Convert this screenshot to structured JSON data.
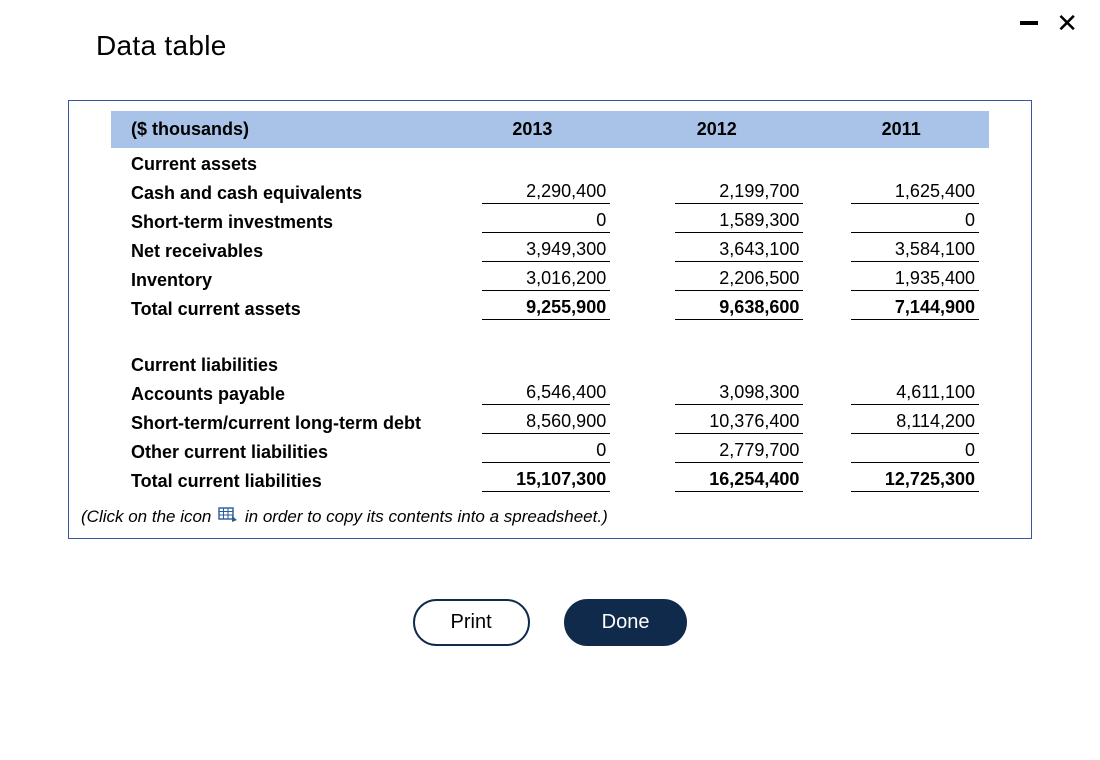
{
  "title": "Data table",
  "columns": {
    "label": "($ thousands)",
    "y1": "2013",
    "y2": "2012",
    "y3": "2011"
  },
  "sections": {
    "assets": {
      "header": "Current assets",
      "rows": [
        {
          "label": "Cash and cash equivalents",
          "v": [
            "2,290,400",
            "2,199,700",
            "1,625,400"
          ]
        },
        {
          "label": "Short-term investments",
          "v": [
            "0",
            "1,589,300",
            "0"
          ]
        },
        {
          "label": "Net receivables",
          "v": [
            "3,949,300",
            "3,643,100",
            "3,584,100"
          ]
        },
        {
          "label": "Inventory",
          "v": [
            "3,016,200",
            "2,206,500",
            "1,935,400"
          ]
        }
      ],
      "total": {
        "label": "Total current assets",
        "v": [
          "9,255,900",
          "9,638,600",
          "7,144,900"
        ]
      }
    },
    "liabilities": {
      "header": "Current liabilities",
      "rows": [
        {
          "label": "Accounts payable",
          "v": [
            "6,546,400",
            "3,098,300",
            "4,611,100"
          ]
        },
        {
          "label": "Short-term/current long-term debt",
          "v": [
            "8,560,900",
            "10,376,400",
            "8,114,200"
          ]
        },
        {
          "label": "Other current liabilities",
          "v": [
            "0",
            "2,779,700",
            "0"
          ]
        }
      ],
      "total": {
        "label": "Total current liabilities",
        "v": [
          "15,107,300",
          "16,254,400",
          "12,725,300"
        ]
      }
    }
  },
  "hint": {
    "pre": "(Click on the icon",
    "post": "in order to copy its contents into a spreadsheet.)"
  },
  "buttons": {
    "print": "Print",
    "done": "Done"
  }
}
